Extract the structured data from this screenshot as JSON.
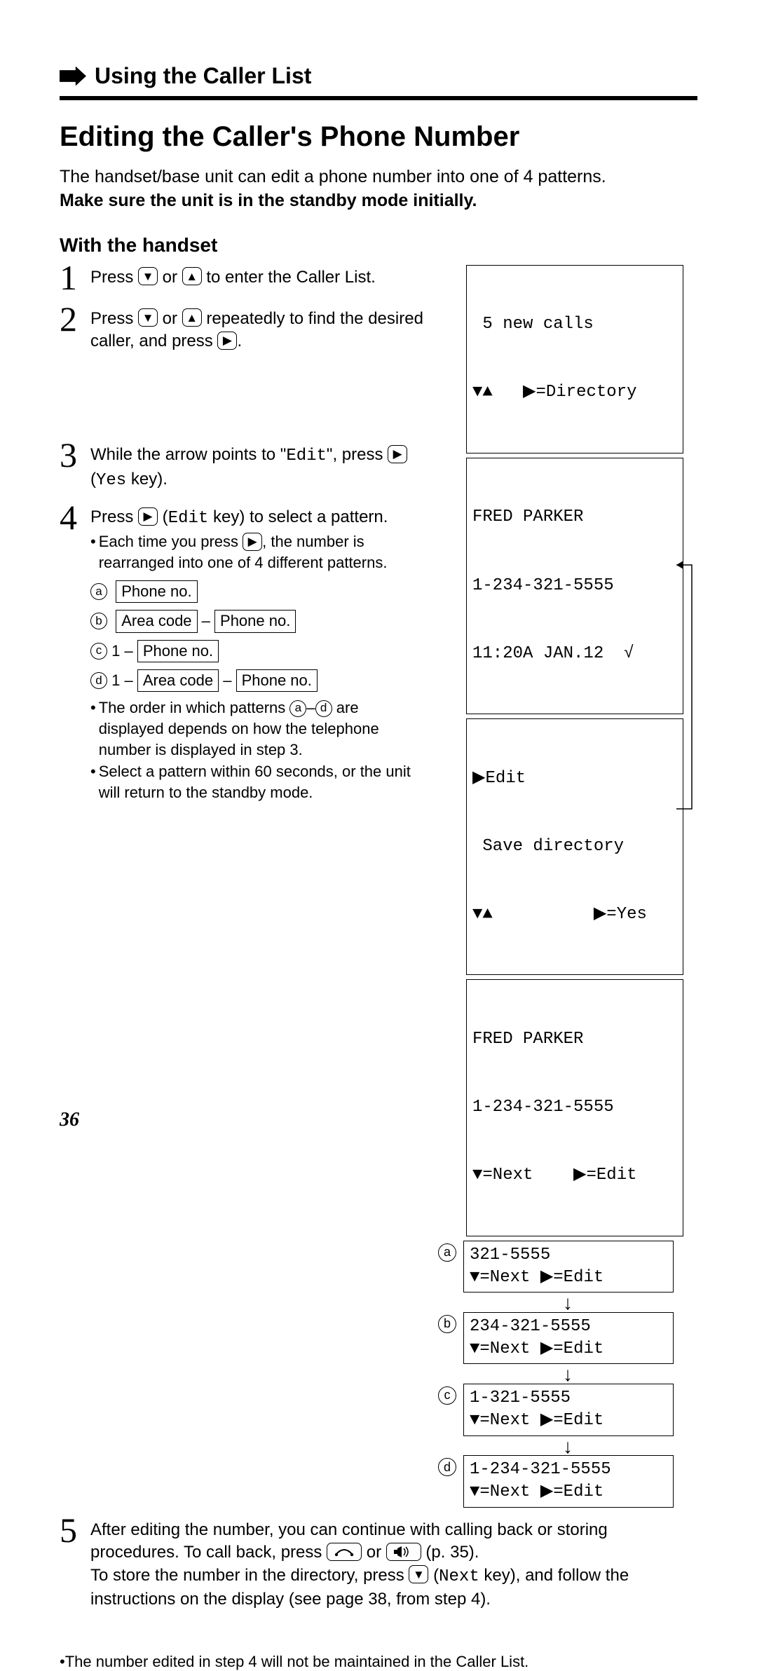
{
  "header": {
    "section": "Using the Caller List"
  },
  "title": "Editing the Caller's Phone Number",
  "intro_line1": "The handset/base unit can edit a phone number into one of 4 patterns.",
  "intro_line2": "Make sure the unit is in the standby mode initially.",
  "subheading": "With the handset",
  "steps": {
    "s1": {
      "num": "1",
      "text_a": "Press ",
      "text_b": " or ",
      "text_c": " to enter the Caller List."
    },
    "s2": {
      "num": "2",
      "text_a": "Press ",
      "text_b": " or ",
      "text_c": " repeatedly to find the desired caller, and press ",
      "text_d": "."
    },
    "s3": {
      "num": "3",
      "text_a": "While the arrow points to \"",
      "edit": "Edit",
      "text_b": "\", press ",
      "paren_a": " (",
      "yes": "Yes",
      "paren_b": " key)."
    },
    "s4": {
      "num": "4",
      "text_a": "Press ",
      "paren_a": " (",
      "edit": "Edit",
      "paren_b": " key) to select a pattern.",
      "bullet1_a": "Each time you press ",
      "bullet1_b": ", the number is rearranged into one of 4 different patterns.",
      "pa_label": "a",
      "pa_box1": "Phone no.",
      "pb_label": "b",
      "pb_box1": "Area code",
      "pb_sep": " – ",
      "pb_box2": "Phone no.",
      "pc_label": "c",
      "pc_pre": " 1 – ",
      "pc_box1": "Phone no.",
      "pd_label": "d",
      "pd_pre": " 1 – ",
      "pd_box1": "Area code",
      "pd_sep": " – ",
      "pd_box2": "Phone no.",
      "bullet2_a": "The order in which patterns ",
      "bullet2_b": "–",
      "bullet2_c": " are displayed depends on how the telephone number is displayed in step 3.",
      "bullet3": "Select a pattern within 60 seconds, or the unit will return to the standby mode."
    },
    "s5": {
      "num": "5",
      "text_a": "After editing the number, you can continue with calling back or storing procedures. To call back, press ",
      "text_b": " or ",
      "text_c": " (p. 35).",
      "text_d": "To store the number in the directory, press ",
      "text_e": " (",
      "nextkey": "Next",
      "text_f": " key), and follow the instructions on the display (see page 38, from step 4)."
    }
  },
  "lcd": {
    "s1": {
      "l1": " 5 new calls",
      "l2": "▼▲   ▶=Directory"
    },
    "s2": {
      "l1": "FRED PARKER",
      "l2": "1-234-321-5555",
      "l3": "11:20A JAN.12  √"
    },
    "s3": {
      "l1": "▶Edit",
      "l2": " Save directory",
      "l3": "▼▲          ▶=Yes"
    },
    "edit": {
      "l1": "FRED PARKER",
      "l2": "1-234-321-5555",
      "l3": "▼=Next    ▶=Edit"
    },
    "pa": {
      "label": "a",
      "l1": "321-5555",
      "l2": "▼=Next    ▶=Edit"
    },
    "pb": {
      "label": "b",
      "l1": "234-321-5555",
      "l2": "▼=Next    ▶=Edit"
    },
    "pc": {
      "label": "c",
      "l1": "1-321-5555",
      "l2": "▼=Next    ▶=Edit"
    },
    "pd": {
      "label": "d",
      "l1": "1-234-321-5555",
      "l2": "▼=Next    ▶=Edit"
    }
  },
  "footnote": "The number edited in step 4 will not be maintained in the Caller List.",
  "pagenum": "36",
  "keys": {
    "down": "▼",
    "up": "▲",
    "right": "▶"
  }
}
